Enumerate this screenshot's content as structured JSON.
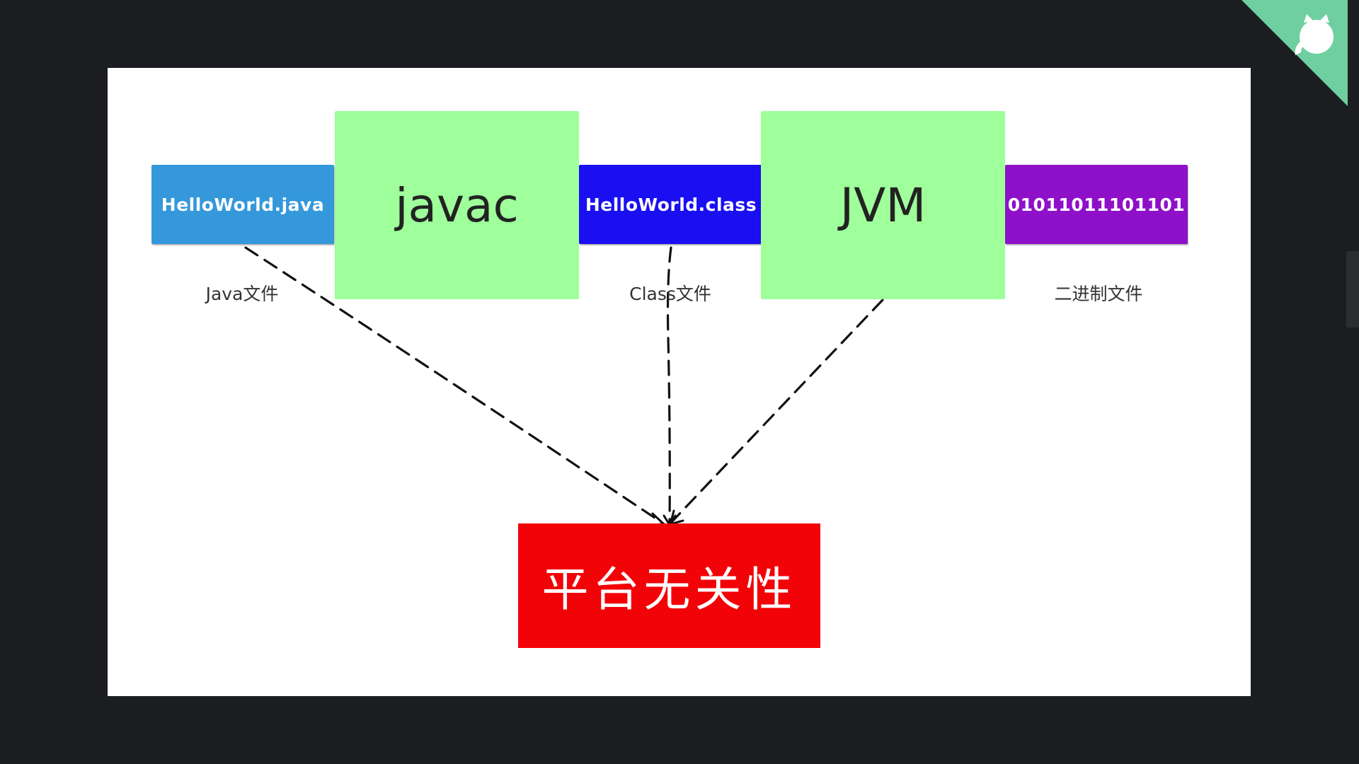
{
  "diagram": {
    "nodes": {
      "java_file": {
        "text": "HelloWorld.java",
        "caption": "Java文件",
        "color": "#3498db"
      },
      "javac": {
        "text": "javac",
        "color": "#9eff9b"
      },
      "class_file": {
        "text": "HelloWorld.class",
        "caption": "Class文件",
        "color": "#1a0ff0"
      },
      "jvm": {
        "text": "JVM",
        "color": "#9eff9b"
      },
      "binary_file": {
        "text": "01011011101101",
        "caption": "二进制文件",
        "color": "#8e10c9"
      },
      "platform": {
        "text": "平台无关性",
        "color": "#f20307"
      }
    },
    "edges": [
      {
        "from": "java_file",
        "to": "platform",
        "style": "dashed"
      },
      {
        "from": "class_file",
        "to": "platform",
        "style": "dashed"
      },
      {
        "from": "jvm",
        "to": "platform",
        "style": "dashed"
      }
    ]
  },
  "corner_badge": {
    "icon": "github-octocat-icon",
    "color": "#6fcfa0"
  }
}
